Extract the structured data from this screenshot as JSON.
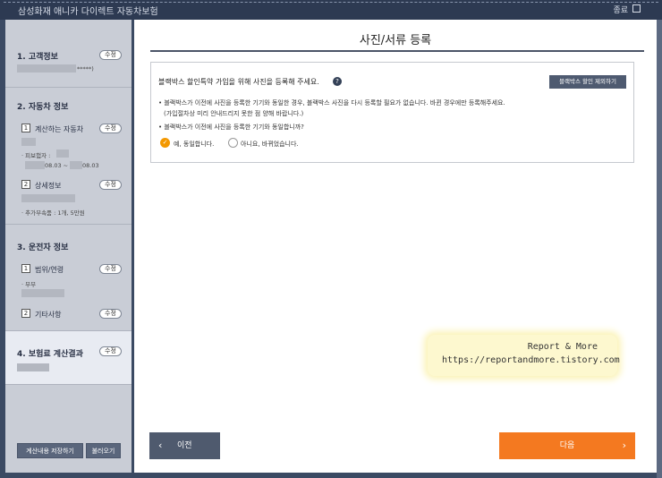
{
  "window": {
    "title": "삼성화재 애니카 다이렉트 자동차보험",
    "close_label": "종료"
  },
  "sidebar": {
    "customer": {
      "title": "1. 고객정보",
      "edit": "수정",
      "masked": "*****)"
    },
    "vehicle": {
      "title": "2. 자동차 정보",
      "edit": "수정",
      "sub1": {
        "num": "1",
        "label": "계산하는 자동차",
        "edit": "수정",
        "insured": "· 피보험자 :",
        "period_a": "08.03 ~",
        "period_b": "08.03"
      },
      "sub2": {
        "num": "2",
        "label": "상세정보",
        "edit": "수정",
        "extras": "· 추가부속품 : 1개, 5만원"
      }
    },
    "driver": {
      "title": "3. 운전자 정보",
      "sub1": {
        "num": "1",
        "label": "범위/연령",
        "edit": "수정",
        "scope": "· 부부"
      },
      "sub2": {
        "num": "2",
        "label": "기타사항",
        "edit": "수정"
      }
    },
    "result": {
      "title": "4. 보험료 계산결과",
      "edit": "수정"
    },
    "buttons": {
      "save": "계산내용 저장하기",
      "load": "불러오기"
    }
  },
  "main": {
    "title": "사진/서류 등록",
    "panel": {
      "heading": "블랙박스 할인특약 가입을 위해 사진을 등록해 주세요.",
      "help": "?",
      "exclude_button": "블랙박스 할인 제외하기",
      "note1": "• 블랙박스가 이전에 사진을 등록한 기기와 동일한 경우, 블랙박스 사진을 다시 등록할 필요가 없습니다. 바뀐 경우에만 등록해주세요.",
      "note2": "(가입절차상 미리 안내드리지 못한 점 양해 바랍니다.)",
      "question": "• 블랙박스가 이전에 사진을 등록한 기기와 동일합니까?",
      "option_yes": "예, 동일합니다.",
      "option_no": "아니요, 바뀌었습니다.",
      "selected": "yes"
    },
    "prev_label": "이전",
    "next_label": "다음",
    "watermark": {
      "line1": "Report & More",
      "line2": "https://reportandmore.tistory.com"
    }
  },
  "colors": {
    "accent": "#f47920",
    "sidebar": "#c9cdd6",
    "titlebar": "#2d3a52",
    "button_dark": "#4f5a6e"
  }
}
